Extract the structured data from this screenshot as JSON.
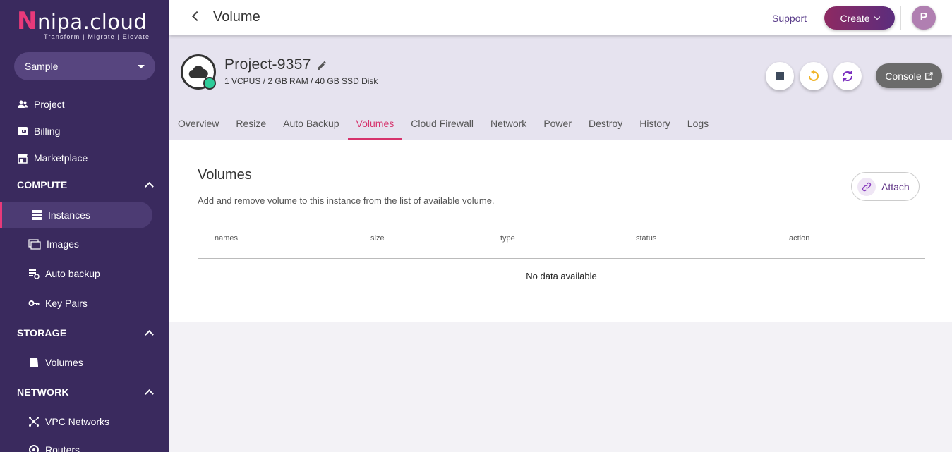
{
  "brand": {
    "logo_letter": "N",
    "logo_rest": "nipa.cloud",
    "tagline": "Transform  |  Migrate  |  Elevate"
  },
  "sidebar": {
    "project": "Sample",
    "items": {
      "project": "Project",
      "billing": "Billing",
      "marketplace": "Marketplace",
      "compute": "COMPUTE",
      "instances": "Instances",
      "images": "Images",
      "auto_backup": "Auto backup",
      "key_pairs": "Key Pairs",
      "storage": "STORAGE",
      "volumes": "Volumes",
      "network": "NETWORK",
      "vpc_networks": "VPC Networks",
      "routers": "Routers"
    }
  },
  "topbar": {
    "title": "Volume",
    "support": "Support",
    "create": "Create",
    "avatar": "P"
  },
  "instance": {
    "name": "Project-9357",
    "spec": "1 VCPUS / 2 GB RAM / 40 GB SSD Disk",
    "console": "Console"
  },
  "tabs": [
    "Overview",
    "Resize",
    "Auto Backup",
    "Volumes",
    "Cloud Firewall",
    "Network",
    "Power",
    "Destroy",
    "History",
    "Logs"
  ],
  "active_tab": "Volumes",
  "volumes": {
    "title": "Volumes",
    "description": "Add and remove volume to this instance from the list of available volume.",
    "attach": "Attach",
    "columns": [
      "names",
      "size",
      "type",
      "status",
      "action"
    ],
    "empty_text": "No data available"
  },
  "colors": {
    "sidebar": "#3a2a5e",
    "accent": "#d6336c",
    "status_running": "#2ecc9a"
  }
}
